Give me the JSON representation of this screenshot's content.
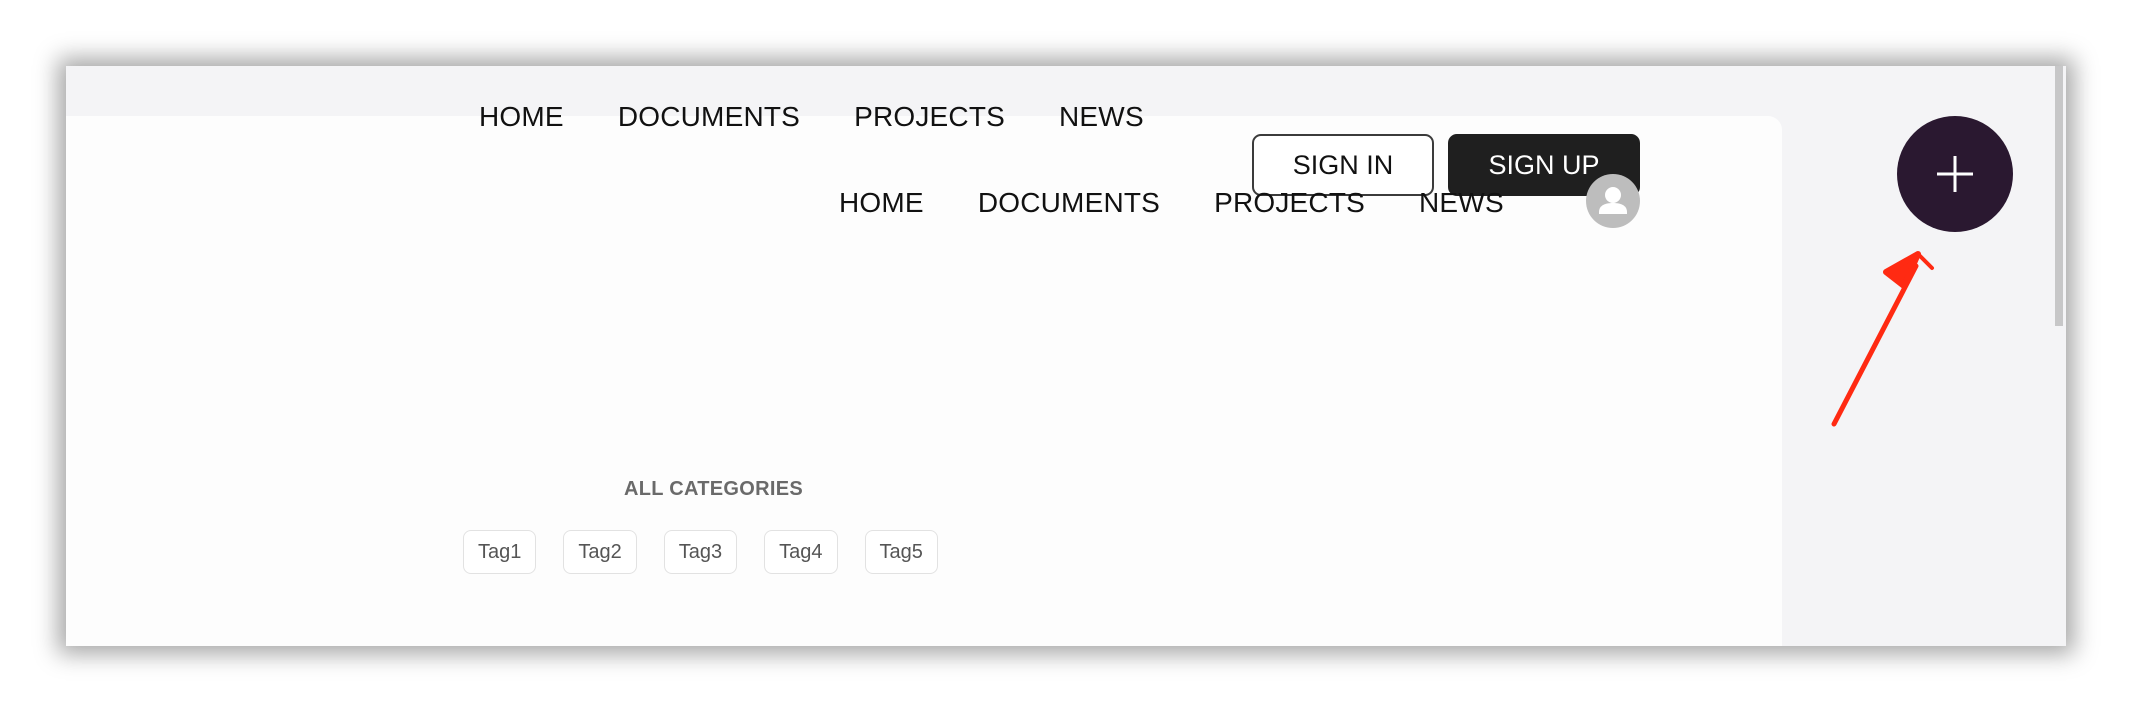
{
  "primary_nav": {
    "items": [
      "HOME",
      "DOCUMENTS",
      "PROJECTS",
      "NEWS"
    ]
  },
  "auth": {
    "sign_in_label": "SIGN IN",
    "sign_up_label": "SIGN UP"
  },
  "secondary_nav": {
    "items": [
      "HOME",
      "DOCUMENTS",
      "PROJECTS",
      "NEWS"
    ]
  },
  "avatar": {
    "icon": "user-avatar-icon"
  },
  "categories": {
    "title": "ALL CATEGORIES",
    "tags": [
      "Tag1",
      "Tag2",
      "Tag3",
      "Tag4",
      "Tag5"
    ]
  },
  "fab": {
    "icon": "plus-icon"
  },
  "annotation": {
    "icon": "red-arrow-icon",
    "color": "#ff2a12"
  },
  "colors": {
    "fab_bg": "#2a1830",
    "signup_bg": "#1f1f1f",
    "page_bg": "#f4f4f6"
  }
}
